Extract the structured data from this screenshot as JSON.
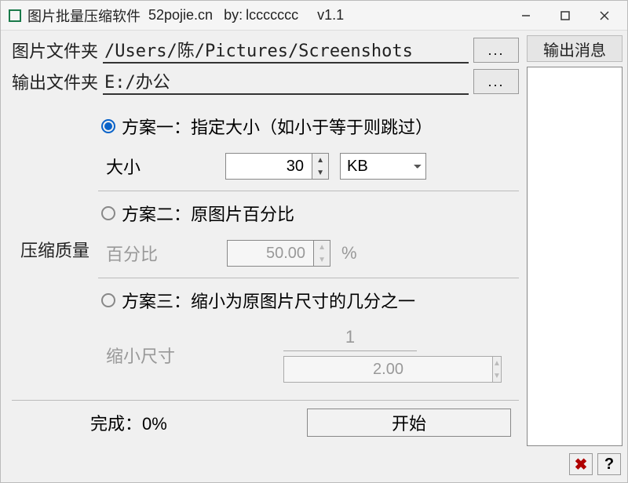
{
  "titlebar": {
    "app_name": "图片批量压缩软件",
    "site": "52pojie.cn",
    "author_prefix": "by:",
    "author": "lccccccc",
    "version": "v1.1"
  },
  "paths": {
    "src_label": "图片文件夹",
    "src_value": "/Users/陈/Pictures/Screenshots",
    "dst_label": "输出文件夹",
    "dst_value": "E:/办公",
    "browse_label": "..."
  },
  "quality": {
    "section_label": "压缩质量",
    "option1": {
      "radio_label": "方案一：指定大小（如小于等于则跳过）",
      "size_label": "大小",
      "size_value": "30",
      "unit_value": "KB"
    },
    "option2": {
      "radio_label": "方案二：原图片百分比",
      "pct_label": "百分比",
      "pct_value": "50.00",
      "pct_unit": "%"
    },
    "option3": {
      "radio_label": "方案三：缩小为原图片尺寸的几分之一",
      "shrink_label": "缩小尺寸",
      "numerator": "1",
      "denominator": "2.00"
    }
  },
  "footer": {
    "progress_prefix": "完成：",
    "progress_value": "0%",
    "start_label": "开始"
  },
  "side": {
    "header": "输出消息",
    "close_icon": "✖",
    "help_icon": "?"
  }
}
